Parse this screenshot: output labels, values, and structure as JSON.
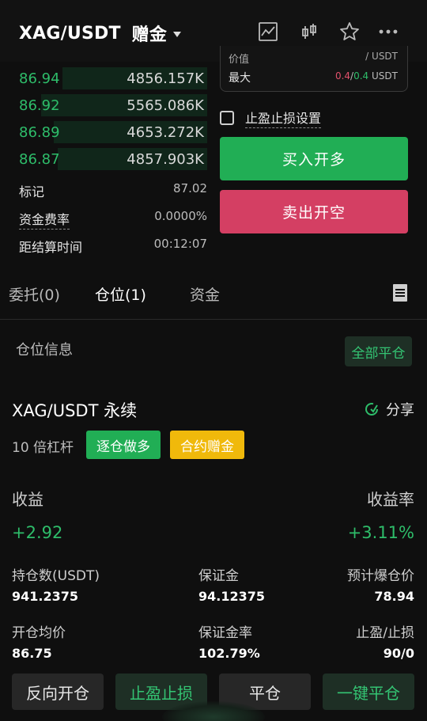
{
  "header": {
    "pair": "XAG/USDT",
    "bonus": "赠金",
    "icons": [
      "chart-icon",
      "candlestick-icon",
      "star-icon",
      "more-icon"
    ]
  },
  "order_book": {
    "rows": [
      {
        "price": "86.94",
        "qty": "4856.157K",
        "depth_pct": 70
      },
      {
        "price": "86.92",
        "qty": "5565.086K",
        "depth_pct": 80
      },
      {
        "price": "86.89",
        "qty": "4653.272K",
        "depth_pct": 74
      },
      {
        "price": "86.87",
        "qty": "4857.903K",
        "depth_pct": 72
      }
    ]
  },
  "market_info": {
    "mark_label": "标记",
    "mark_value": "87.02",
    "funding_label": "资金费率",
    "funding_value": "0.0000%",
    "settle_label": "距结算时间",
    "settle_value": "00:12:07"
  },
  "order_panel": {
    "price_label": "价值",
    "price_value": "/ USDT",
    "max_label": "最大",
    "max_sell": "0.4",
    "max_sep": "/",
    "max_buy": "0.4",
    "max_unit": "USDT",
    "tpsl_label": "止盈止损设置",
    "buy_label": "买入开多",
    "sell_label": "卖出开空"
  },
  "tabs": {
    "orders": "委托(0)",
    "positions": "仓位(1)",
    "assets": "资金"
  },
  "position": {
    "section_title": "仓位信息",
    "close_all": "全部平仓",
    "pair": "XAG/USDT 永续",
    "share": "分享",
    "leverage": "10 倍杠杆",
    "tag_mode": "逐仓做多",
    "tag_bonus": "合约赠金",
    "pnl_label": "收益",
    "pnl_value": "+2.92",
    "roe_label": "收益率",
    "roe_value": "+3.11%",
    "size_label": "持仓数(USDT)",
    "size_value": "941.2375",
    "margin_label": "保证金",
    "margin_value": "94.12375",
    "liq_label": "预计爆仓价",
    "liq_value": "78.94",
    "entry_label": "开仓均价",
    "entry_value": "86.75",
    "margin_ratio_label": "保证金率",
    "margin_ratio_value": "102.79%",
    "tpsl_label": "止盈/止损",
    "tpsl_value": "90/0"
  },
  "actions": {
    "reverse": "反向开仓",
    "tpsl": "止盈止损",
    "close": "平仓",
    "quick_close": "一键平仓"
  },
  "colors": {
    "buy_green": "#21ae55",
    "sell_red": "#d43f63",
    "bonus_yellow": "#f0b90b",
    "text_green": "#2ebd6a"
  }
}
